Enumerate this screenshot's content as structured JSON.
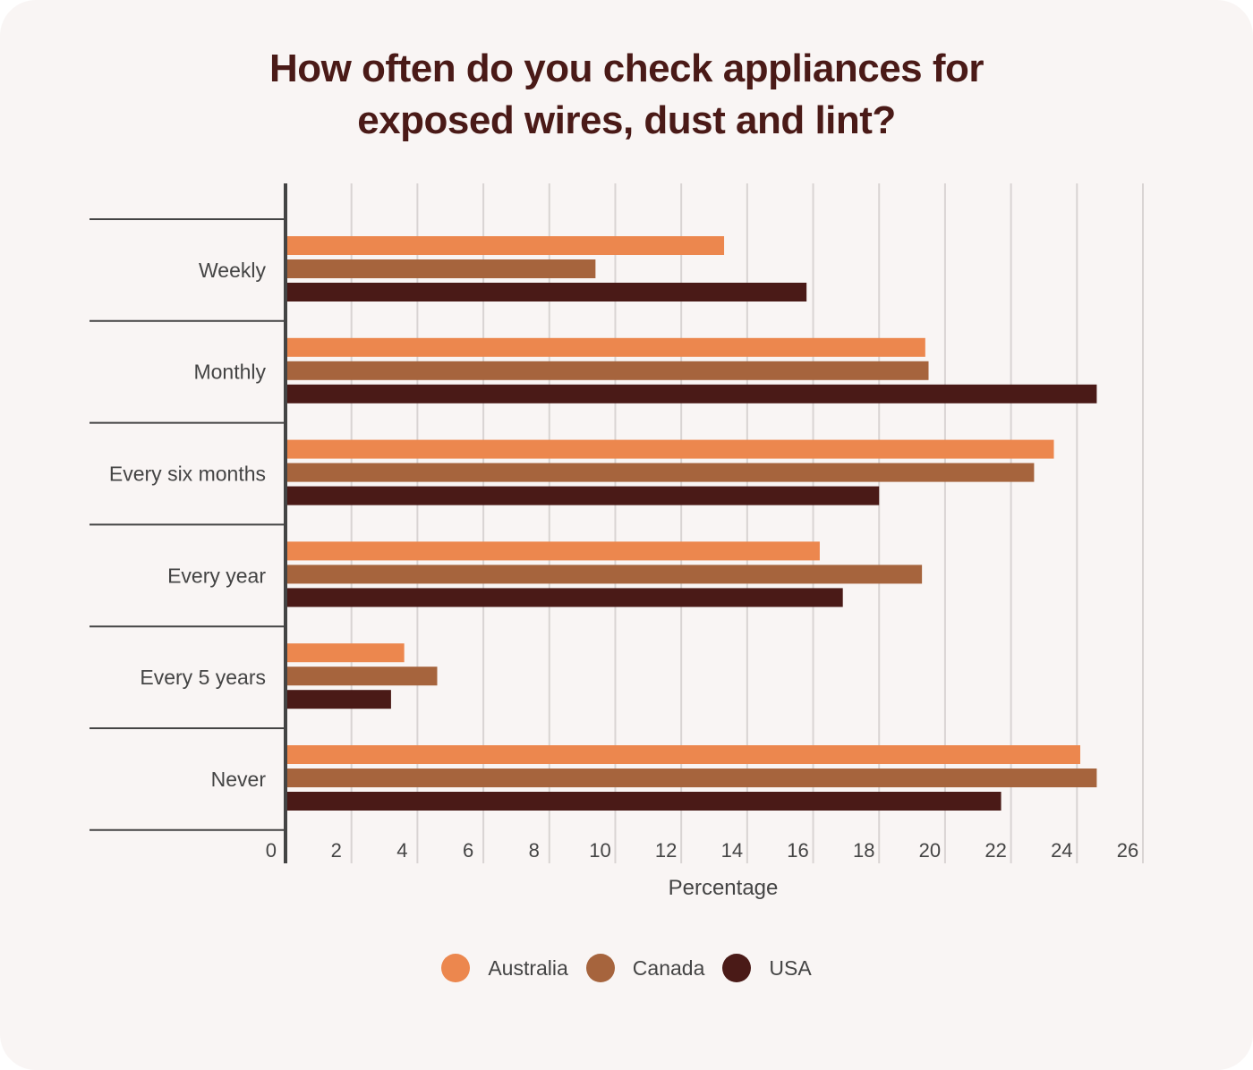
{
  "chart_data": {
    "type": "bar",
    "orientation": "horizontal",
    "title": "How often do you check appliances for exposed wires, dust and lint?",
    "title_lines": [
      "How often do you check appliances for",
      "exposed wires, dust and lint?"
    ],
    "xlabel": "Percentage",
    "ylabel": "",
    "xlim": [
      0,
      26
    ],
    "xticks": [
      0,
      2,
      4,
      6,
      8,
      10,
      12,
      14,
      16,
      18,
      20,
      22,
      24,
      26
    ],
    "grid": true,
    "legend_position": "bottom",
    "categories": [
      "Weekly",
      "Monthly",
      "Every six months",
      "Every year",
      "Every 5 years",
      "Never"
    ],
    "series": [
      {
        "name": "Australia",
        "color": "#ec874e",
        "values": [
          13.3,
          19.4,
          23.3,
          16.2,
          3.6,
          24.1
        ]
      },
      {
        "name": "Canada",
        "color": "#a6643d",
        "values": [
          9.4,
          19.5,
          22.7,
          19.3,
          4.6,
          24.6
        ]
      },
      {
        "name": "USA",
        "color": "#4a1a17",
        "values": [
          15.8,
          24.6,
          18.0,
          16.9,
          3.2,
          21.7
        ]
      }
    ]
  }
}
